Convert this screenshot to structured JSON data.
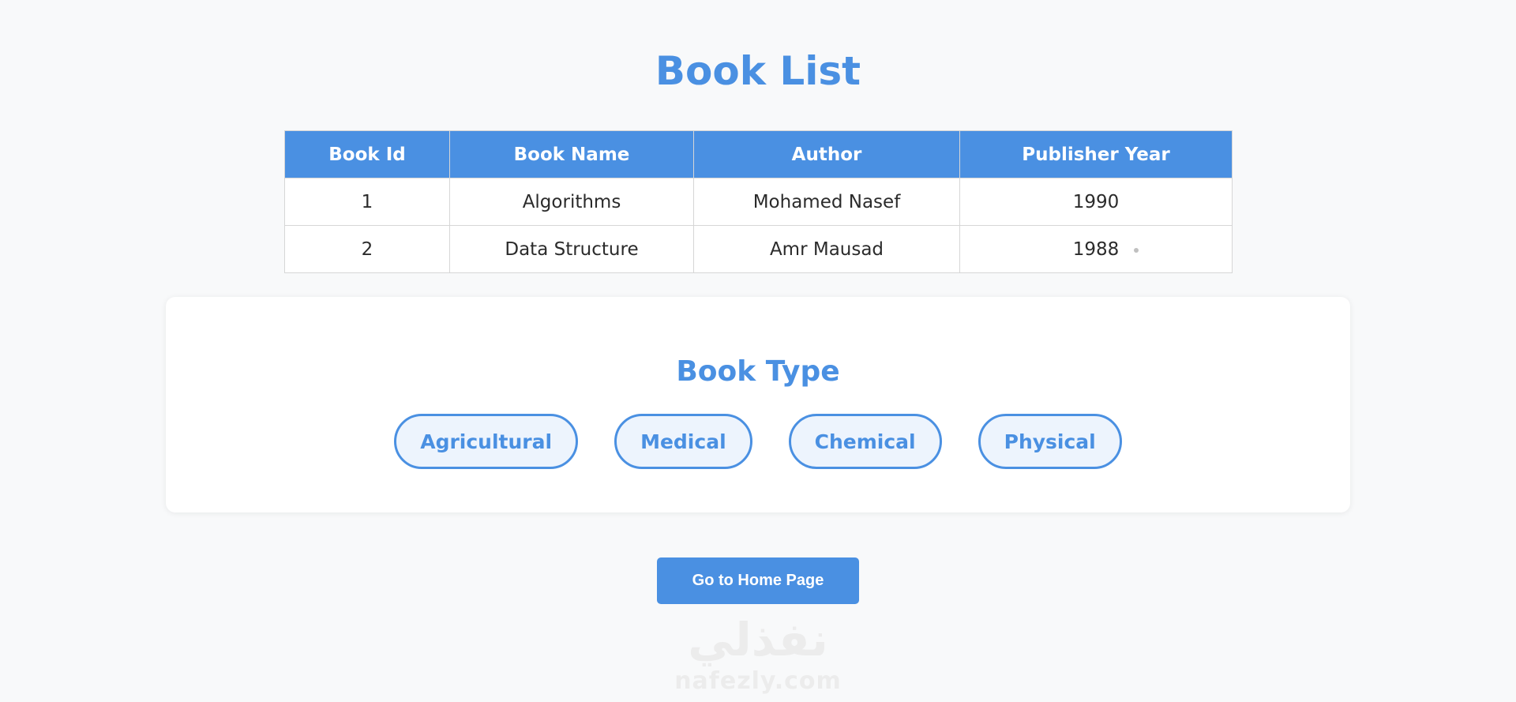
{
  "page": {
    "title": "Book List"
  },
  "table": {
    "headers": [
      "Book Id",
      "Book Name",
      "Author",
      "Publisher Year"
    ],
    "rows": [
      [
        "1",
        "Algorithms",
        "Mohamed Nasef",
        "1990"
      ],
      [
        "2",
        "Data Structure",
        "Amr Mausad",
        "1988"
      ]
    ]
  },
  "book_types": {
    "title": "Book Type",
    "items": [
      "Agricultural",
      "Medical",
      "Chemical",
      "Physical"
    ]
  },
  "home_button": {
    "label": "Go to Home Page"
  },
  "watermark": {
    "arabic": "نفذلي",
    "url": "nafezly.com"
  },
  "colors": {
    "accent": "#4a90e2",
    "background": "#f8f9fa",
    "pill_fill": "#edf4fd"
  }
}
